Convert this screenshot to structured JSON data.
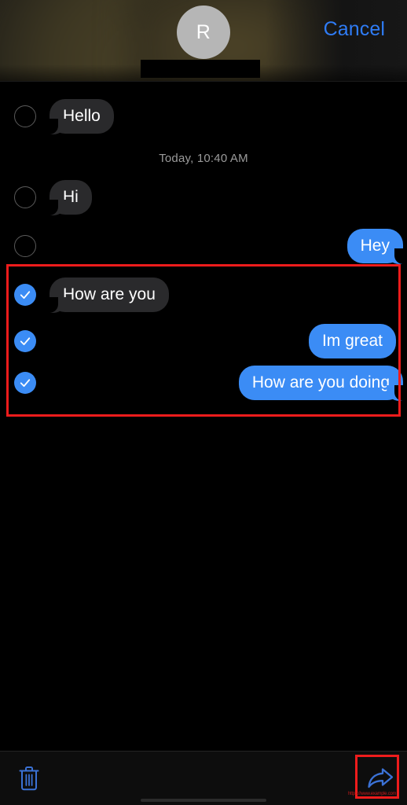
{
  "header": {
    "avatar_initial": "R",
    "avatar_name": "avatar",
    "cancel_label": "Cancel",
    "redacted_name": ""
  },
  "thread": {
    "timestamp": "Today, 10:40 AM",
    "messages": [
      {
        "text": "Hello",
        "side": "incoming",
        "selected": false
      },
      {
        "text": "Hi",
        "side": "incoming",
        "selected": false
      },
      {
        "text": "Hey",
        "side": "outgoing",
        "selected": false
      },
      {
        "text": "How are you",
        "side": "incoming",
        "selected": true
      },
      {
        "text": "Im great",
        "side": "outgoing",
        "selected": true
      },
      {
        "text": "How are you doing",
        "side": "outgoing",
        "selected": true
      }
    ]
  },
  "toolbar": {
    "delete_label": "Delete",
    "forward_label": "Forward"
  },
  "annotations": {
    "selection_box_label": "selected-messages-highlight",
    "forward_box_label": "forward-button-highlight",
    "micro_caption": "https://www.example.com"
  },
  "colors": {
    "accent_blue": "#3b8cf5",
    "cancel_blue": "#2f7cf6",
    "incoming_bubble": "#2a2a2c",
    "outgoing_bubble": "#3b8cf5",
    "annotation_red": "#ee1c1c",
    "background": "#000000",
    "avatar_gray": "#b6b6b6",
    "timestamp_gray": "#9b9b9b"
  }
}
